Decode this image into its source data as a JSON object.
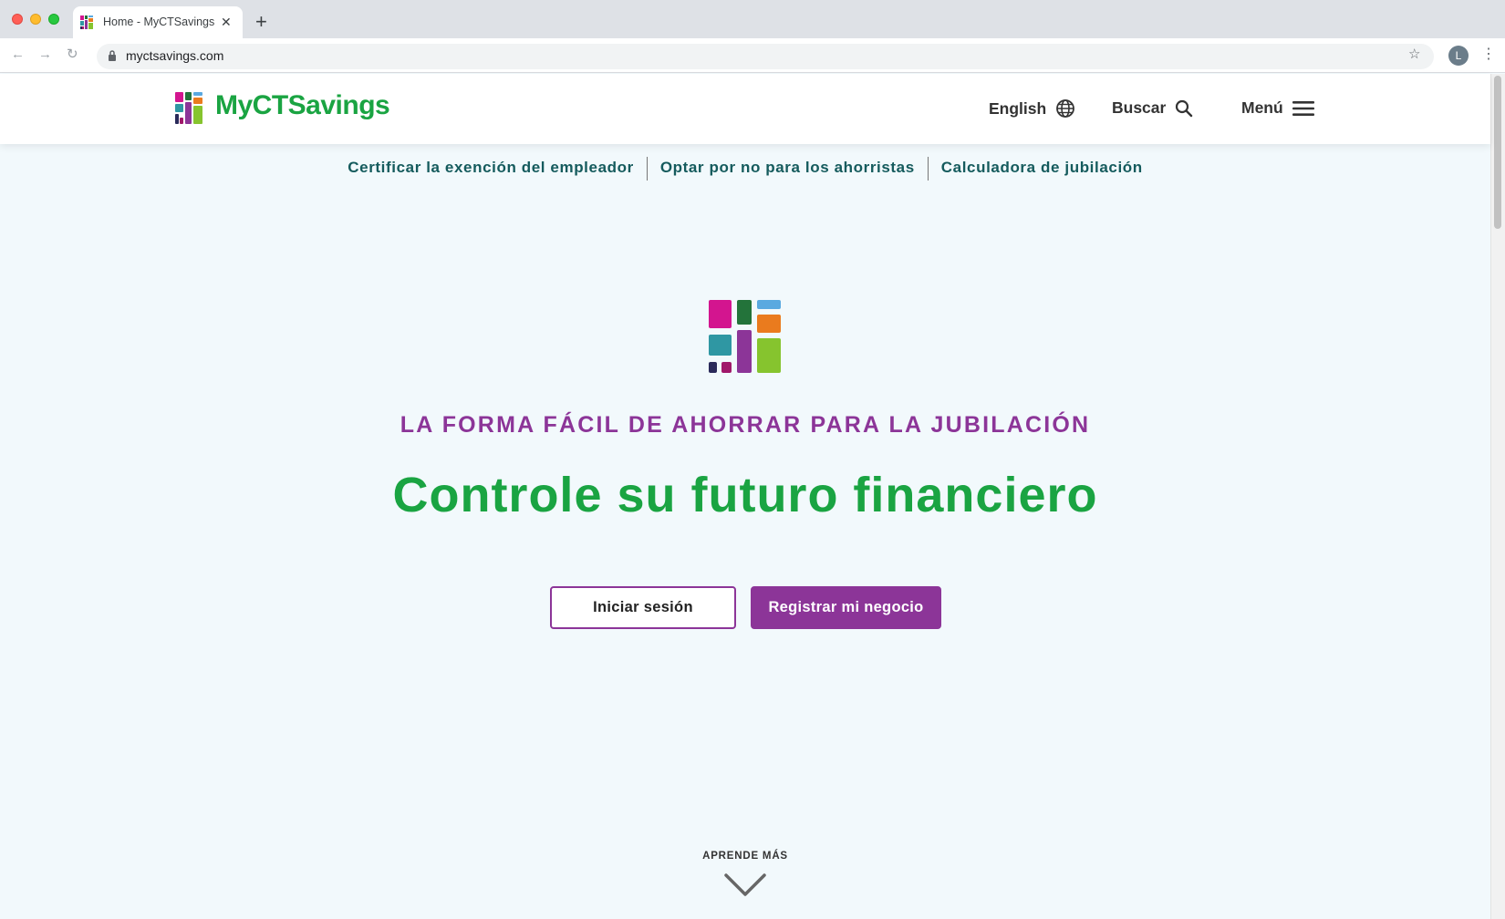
{
  "browser": {
    "tab_title": "Home - MyCTSavings",
    "url": "myctsavings.com",
    "profile_initial": "L"
  },
  "header": {
    "logo_text": "MyCTSavings",
    "language": "English",
    "search": "Buscar",
    "menu": "Menú"
  },
  "sublinks": [
    "Certificar la exención del empleador",
    "Optar por no para los ahorristas",
    "Calculadora de jubilación"
  ],
  "hero": {
    "eyebrow": "LA FORMA FÁCIL DE AHORRAR PARA LA JUBILACIÓN",
    "headline": "Controle su futuro financiero",
    "login_button": "Iniciar sesión",
    "register_button": "Registrar mi negocio",
    "learn_more": "APRENDE MÁS"
  },
  "colors": {
    "brand_green": "#1aa442",
    "brand_purple": "#8c3598",
    "link_teal": "#155b5d",
    "page_bg": "#f2f9fc"
  },
  "icons": [
    "globe-icon",
    "search-icon",
    "hamburger-menu-icon",
    "chevron-down-icon",
    "lock-icon",
    "star-icon"
  ]
}
